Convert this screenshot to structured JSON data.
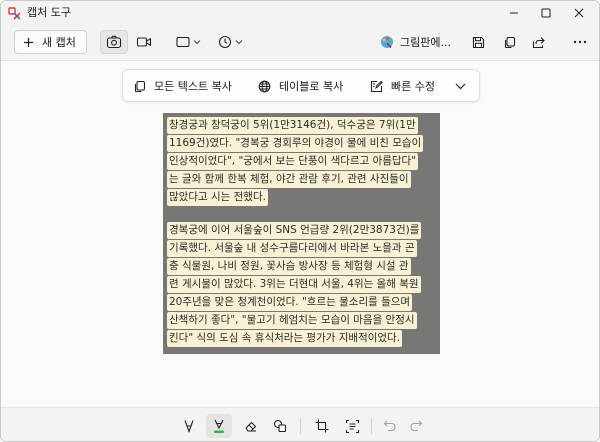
{
  "window": {
    "title": "캡처 도구"
  },
  "toolbar": {
    "new_capture_label": "새 캡처",
    "paint_label": "그림판에..."
  },
  "text_actions": {
    "copy_all_text": "모든 텍스트 복사",
    "copy_as_table": "테이블로 복사",
    "quick_redact": "빠른 수정"
  },
  "content": {
    "paragraphs": [
      [
        "창경궁과 창덕궁이 5위(1만3146건), 덕수궁은 7위(1만",
        "1169건)였다. \"경복궁 경회루의 야경이 물에 비친 모습이",
        "인상적이었다\", \"궁에서 보는 단풍이 색다르고 아름답다\"",
        "는 글와 함께 한복 체험, 야간 관람 후기, 관련 사진들이",
        "많았다고 시는 전했다."
      ],
      [
        "경복궁에 이어 서울숲이 SNS 언급량 2위(2만3873건)를",
        "기록했다. 서울숲 내 성수구름다리에서 바라본 노을과 곤",
        "충 식물원, 나비 정원, 꽃사슴 방사장 등 체험형 시설 관",
        "련 게시물이 많았다. 3위는 더현대 서울, 4위는 올해 복원",
        "20주년을 맞은 청계천이었다. \"흐르는 물소리를 들으며",
        "산책하기 좋다\", \"물고기 헤엄치는 모습이 마음을 안정시",
        "킨다\" 식의 도심 속 휴식처라는 평가가 지배적이었다."
      ]
    ]
  },
  "colors": {
    "highlight": "#f8f1d3",
    "image_background": "#777775",
    "pen_active": "#2fb34a"
  },
  "icons": {
    "app": "snipping-tool-icon",
    "camera": "camera-icon",
    "video": "video-icon",
    "shape": "rectangle-icon",
    "timer": "clock-icon",
    "paint": "paint-icon",
    "save": "save-icon",
    "copy": "copy-icon",
    "share": "share-icon",
    "more": "more-icon"
  }
}
